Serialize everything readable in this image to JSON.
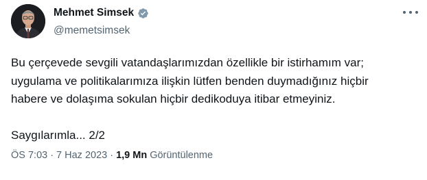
{
  "author": {
    "display_name": "Mehmet Simsek",
    "handle": "@memetsimsek",
    "verified_color": "#829aab"
  },
  "tweet": {
    "lines": [
      "Bu çerçevede sevgili vatandaşlarımızdan özellikle bir istirhamım var;",
      "uygulama ve politikalarımıza ilişkin lütfen benden duymadığınız hiçbir",
      "habere ve dolaşıma sokulan hiçbir dedikoduya itibar etmeyiniz.",
      "Saygılarımla... 2/2"
    ]
  },
  "meta": {
    "time": "ÖS 7:03",
    "separator": "·",
    "date": "7 Haz 2023",
    "views_count": "1,9 Mn",
    "views_label": "Görüntülenme"
  },
  "icons": {
    "verified": "verified-badge-icon",
    "more": "more-options-icon"
  }
}
